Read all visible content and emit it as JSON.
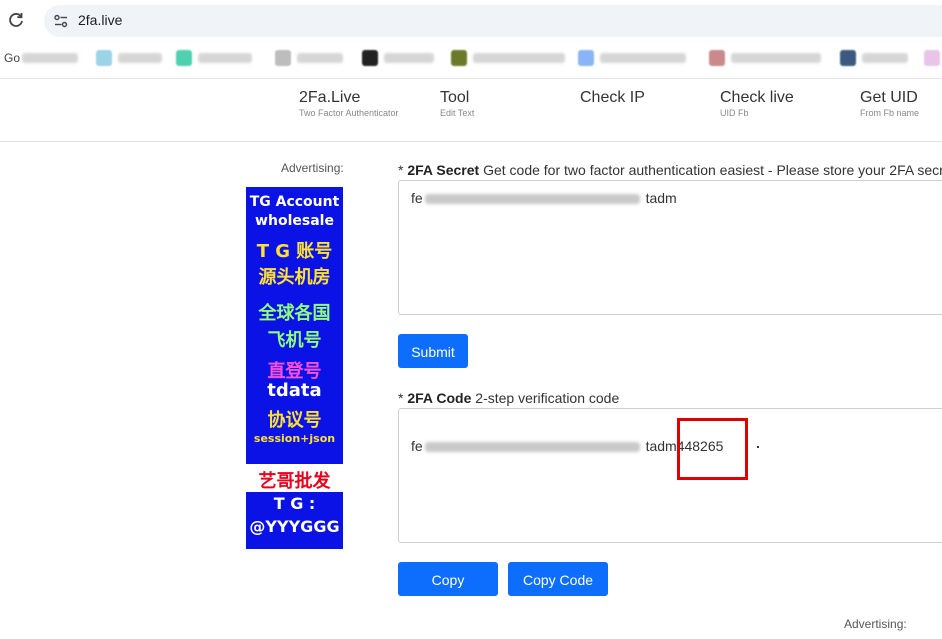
{
  "browser": {
    "url": "2fa.live",
    "bookmarks": [
      {
        "label": "Go",
        "icon": "google-icon"
      },
      {
        "label": "",
        "icon": "bookmark-icon"
      },
      {
        "label": "",
        "icon": "bookmark-icon"
      },
      {
        "label": "",
        "icon": "bookmark-icon"
      },
      {
        "label": "",
        "icon": "bookmark-icon"
      },
      {
        "label": "",
        "icon": "bookmark-icon"
      },
      {
        "label": "",
        "icon": "bookmark-icon"
      },
      {
        "label": "",
        "icon": "bookmark-icon"
      },
      {
        "label": "",
        "icon": "bookmark-icon"
      }
    ]
  },
  "nav": {
    "items": [
      {
        "title": "2Fa.Live",
        "sub": "Two Factor Authenticator"
      },
      {
        "title": "Tool",
        "sub": "Edit Text"
      },
      {
        "title": "Check IP",
        "sub": ""
      },
      {
        "title": "Check live",
        "sub": "UID Fb"
      },
      {
        "title": "Get UID",
        "sub": "From Fb name"
      }
    ]
  },
  "ad": {
    "label_top": "Advertising:",
    "label_bottom": "Advertising:",
    "lines": [
      "TG Account",
      "wholesale",
      "T G 账号",
      "源头机房",
      "全球各国",
      "飞机号",
      "直登号",
      "tdata",
      "协议号",
      "session+json",
      "艺哥批发",
      "T G :",
      "@YYYGGG"
    ]
  },
  "secret": {
    "required_mark": "* ",
    "title": "2FA Secret",
    "desc": " Get code for two factor authentication easiest - Please store your 2FA secr",
    "prefix": "fe",
    "suffix": "tadm"
  },
  "code": {
    "required_mark": "* ",
    "title": "2FA Code",
    "desc": " 2-step verification code",
    "prefix": "fe",
    "suffix": "tadm",
    "value": "448265"
  },
  "buttons": {
    "submit": "Submit",
    "copy": "Copy",
    "copy_code": "Copy Code"
  },
  "colors": {
    "primary": "#0d6efd",
    "ad_background": "#0b12e6",
    "highlight": "#e00000"
  }
}
